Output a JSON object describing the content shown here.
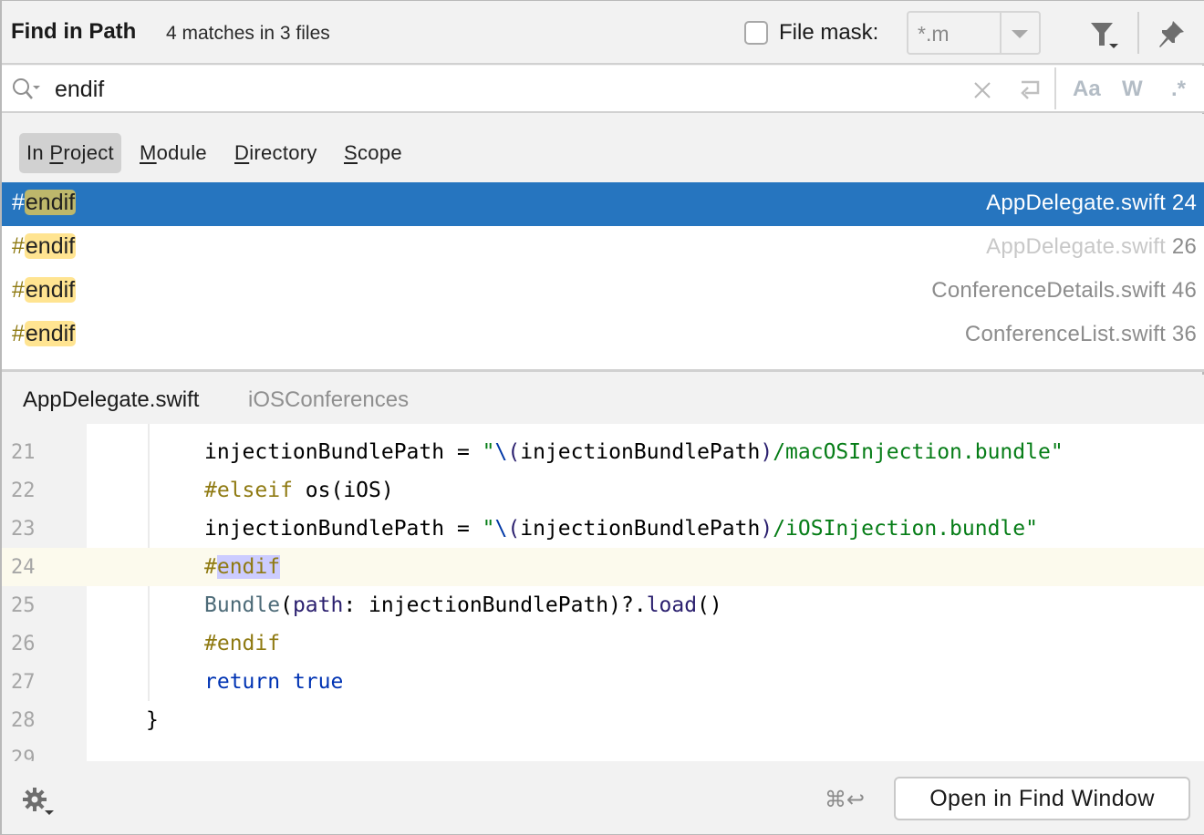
{
  "header": {
    "title": "Find in Path",
    "match_summary": "4 matches in 3 files",
    "file_mask_label": "File mask:",
    "file_mask_checked": false,
    "file_mask_value": "*.m",
    "icons": [
      "filter-icon",
      "pin-icon"
    ]
  },
  "search": {
    "query": "endif",
    "icons": [
      "search-icon",
      "clear-icon",
      "newline-icon"
    ],
    "options": {
      "match_case": "Aa",
      "words": "W",
      "regex": ".*"
    }
  },
  "scopes": [
    {
      "pre": "In ",
      "mnemonic": "P",
      "post": "roject",
      "active": true
    },
    {
      "pre": "",
      "mnemonic": "M",
      "post": "odule",
      "active": false
    },
    {
      "pre": "",
      "mnemonic": "D",
      "post": "irectory",
      "active": false
    },
    {
      "pre": "",
      "mnemonic": "S",
      "post": "cope",
      "active": false
    }
  ],
  "results": [
    {
      "prefix": "#",
      "match": "endif",
      "file": "AppDelegate.swift",
      "line": "24",
      "selected": true,
      "dim_file": false
    },
    {
      "prefix": "#",
      "match": "endif",
      "file": "AppDelegate.swift",
      "line": "26",
      "selected": false,
      "dim_file": true
    },
    {
      "prefix": "#",
      "match": "endif",
      "file": "ConferenceDetails.swift",
      "line": "46",
      "selected": false,
      "dim_file": false
    },
    {
      "prefix": "#",
      "match": "endif",
      "file": "ConferenceList.swift",
      "line": "36",
      "selected": false,
      "dim_file": false
    }
  ],
  "preview": {
    "file": "AppDelegate.swift",
    "module": "iOSConferences",
    "current_line": "24",
    "lines": [
      {
        "n": "21",
        "indent": "    ",
        "text": "injectionBundlePath = \"\\(injectionBundlePath)/macOSInjection.bundle\""
      },
      {
        "n": "22",
        "indent": "    ",
        "text": "#elseif os(iOS)"
      },
      {
        "n": "23",
        "indent": "    ",
        "text": "injectionBundlePath = \"\\(injectionBundlePath)/iOSInjection.bundle\""
      },
      {
        "n": "24",
        "indent": "    ",
        "text": "#endif"
      },
      {
        "n": "25",
        "indent": "    ",
        "text": "Bundle(path: injectionBundlePath)?.load()"
      },
      {
        "n": "26",
        "indent": "    ",
        "text": "#endif"
      },
      {
        "n": "27",
        "indent": "    ",
        "text": "return true"
      },
      {
        "n": "28",
        "indent": "",
        "text": "}"
      },
      {
        "n": "29",
        "indent": "",
        "text": ""
      }
    ]
  },
  "footer": {
    "settings_icon": "gear-icon",
    "shortcut": "⌘↩",
    "open_button": "Open in Find Window"
  },
  "colors": {
    "selection": "#2675bf",
    "match_highlight": "#ffe491",
    "editor_match": "#ccccff",
    "current_line": "#fcfaed",
    "directive": "#8f7a12",
    "string": "#067d17",
    "keyword": "#0033b3"
  }
}
